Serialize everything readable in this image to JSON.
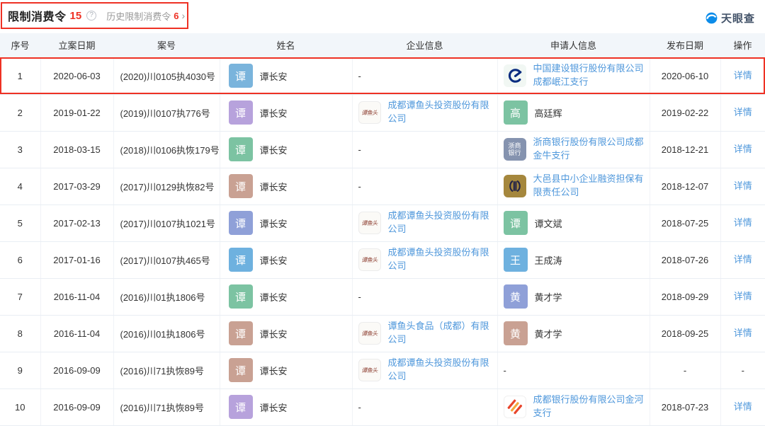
{
  "colors": {
    "accent_red": "#ee3124",
    "link_blue": "#4e97db",
    "header_bg": "#f2f6fa"
  },
  "header": {
    "title": "限制消费令",
    "count": "15",
    "help_icon": "?",
    "history_label": "历史限制消费令",
    "history_count": "6",
    "chevron": "›",
    "brand": "天眼查"
  },
  "logos": {
    "tyt": {
      "label": "谭鱼头"
    },
    "zs": {
      "line1": "浙商",
      "line2": "银行"
    }
  },
  "table": {
    "headers": [
      "序号",
      "立案日期",
      "案号",
      "姓名",
      "企业信息",
      "申请人信息",
      "发布日期",
      "操作"
    ],
    "rows": [
      {
        "no": "1",
        "filing_date": "2020-06-03",
        "case_no": "(2020)川0105执4030号",
        "person": {
          "initial": "谭",
          "name": "谭长安",
          "color": "#7ab4dc"
        },
        "company": {
          "kind": "dash",
          "text": "-"
        },
        "applicant": {
          "kind": "logo",
          "logo": "ccb",
          "name": "中国建设银行股份有限公司成都岷江支行"
        },
        "publish_date": "2020-06-10",
        "action": "详情",
        "highlighted": true
      },
      {
        "no": "2",
        "filing_date": "2019-01-22",
        "case_no": "(2019)川0107执776号",
        "person": {
          "initial": "谭",
          "name": "谭长安",
          "color": "#b7a2dc"
        },
        "company": {
          "kind": "logo",
          "logo": "tyt",
          "name": "成都谭鱼头投资股份有限公司"
        },
        "applicant": {
          "kind": "avatar",
          "initial": "高",
          "color": "#7cc3a2",
          "name": "高廷辉"
        },
        "publish_date": "2019-02-22",
        "action": "详情",
        "highlighted": false
      },
      {
        "no": "3",
        "filing_date": "2018-03-15",
        "case_no": "(2018)川0106执恢179号",
        "person": {
          "initial": "谭",
          "name": "谭长安",
          "color": "#7cc3a2"
        },
        "company": {
          "kind": "dash",
          "text": "-"
        },
        "applicant": {
          "kind": "logo",
          "logo": "zs",
          "name": "浙商银行股份有限公司成都金牛支行"
        },
        "publish_date": "2018-12-21",
        "action": "详情",
        "highlighted": false
      },
      {
        "no": "4",
        "filing_date": "2017-03-29",
        "case_no": "(2017)川0129执恢82号",
        "person": {
          "initial": "谭",
          "name": "谭长安",
          "color": "#c9a193"
        },
        "company": {
          "kind": "dash",
          "text": "-"
        },
        "applicant": {
          "kind": "logo",
          "logo": "dy",
          "name": "大邑县中小企业融资担保有限责任公司"
        },
        "publish_date": "2018-12-07",
        "action": "详情",
        "highlighted": false
      },
      {
        "no": "5",
        "filing_date": "2017-02-13",
        "case_no": "(2017)川0107执1021号",
        "person": {
          "initial": "谭",
          "name": "谭长安",
          "color": "#8fa0d8"
        },
        "company": {
          "kind": "logo",
          "logo": "tyt",
          "name": "成都谭鱼头投资股份有限公司"
        },
        "applicant": {
          "kind": "avatar",
          "initial": "谭",
          "color": "#7cc3a2",
          "name": "谭文斌"
        },
        "publish_date": "2018-07-25",
        "action": "详情",
        "highlighted": false
      },
      {
        "no": "6",
        "filing_date": "2017-01-16",
        "case_no": "(2017)川0107执465号",
        "person": {
          "initial": "谭",
          "name": "谭长安",
          "color": "#6eb1df"
        },
        "company": {
          "kind": "logo",
          "logo": "tyt",
          "name": "成都谭鱼头投资股份有限公司"
        },
        "applicant": {
          "kind": "avatar",
          "initial": "王",
          "color": "#6eb1df",
          "name": "王成涛"
        },
        "publish_date": "2018-07-26",
        "action": "详情",
        "highlighted": false
      },
      {
        "no": "7",
        "filing_date": "2016-11-04",
        "case_no": "(2016)川01执1806号",
        "person": {
          "initial": "谭",
          "name": "谭长安",
          "color": "#7cc3a2"
        },
        "company": {
          "kind": "dash",
          "text": "-"
        },
        "applicant": {
          "kind": "avatar",
          "initial": "黄",
          "color": "#8fa0d8",
          "name": "黄才学"
        },
        "publish_date": "2018-09-29",
        "action": "详情",
        "highlighted": false
      },
      {
        "no": "8",
        "filing_date": "2016-11-04",
        "case_no": "(2016)川01执1806号",
        "person": {
          "initial": "谭",
          "name": "谭长安",
          "color": "#c9a193"
        },
        "company": {
          "kind": "logo",
          "logo": "tyt",
          "name": "谭鱼头食品（成都）有限公司"
        },
        "applicant": {
          "kind": "avatar",
          "initial": "黄",
          "color": "#c9a193",
          "name": "黄才学"
        },
        "publish_date": "2018-09-25",
        "action": "详情",
        "highlighted": false
      },
      {
        "no": "9",
        "filing_date": "2016-09-09",
        "case_no": "(2016)川71执恢89号",
        "person": {
          "initial": "谭",
          "name": "谭长安",
          "color": "#c9a193"
        },
        "company": {
          "kind": "logo",
          "logo": "tyt",
          "name": "成都谭鱼头投资股份有限公司"
        },
        "applicant": {
          "kind": "dash",
          "text": "-"
        },
        "publish_date": "-",
        "action": "-",
        "highlighted": false
      },
      {
        "no": "10",
        "filing_date": "2016-09-09",
        "case_no": "(2016)川71执恢89号",
        "person": {
          "initial": "谭",
          "name": "谭长安",
          "color": "#b7a2dc"
        },
        "company": {
          "kind": "dash",
          "text": "-"
        },
        "applicant": {
          "kind": "logo",
          "logo": "cdb",
          "name": "成都银行股份有限公司金河支行"
        },
        "publish_date": "2018-07-23",
        "action": "详情",
        "highlighted": false
      }
    ]
  }
}
